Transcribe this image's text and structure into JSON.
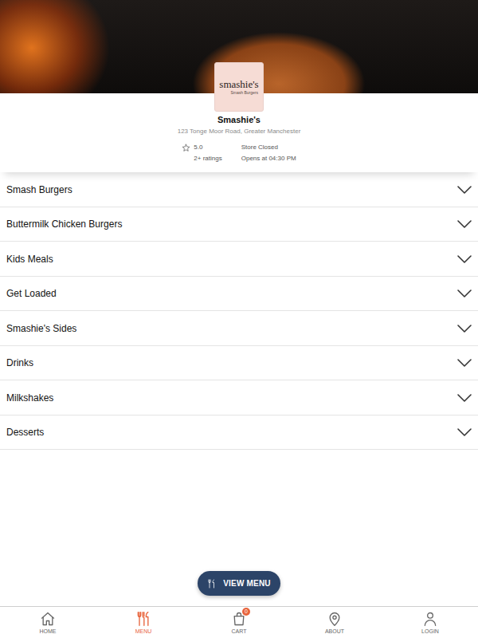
{
  "store": {
    "logo": {
      "title": "smashie's",
      "subtitle": "Smash Burgers"
    },
    "name": "Smashie's",
    "address": "123 Tonge Moor Road, Greater Manchester",
    "rating": "5.0",
    "ratings_count": "2+ ratings",
    "status": "Store Closed",
    "opens": "Opens at 04:30 PM"
  },
  "categories": [
    {
      "label": "Smash Burgers",
      "expanded": false
    },
    {
      "label": "Buttermilk Chicken Burgers",
      "expanded": false
    },
    {
      "label": "Kids Meals",
      "expanded": false
    },
    {
      "label": "Get Loaded",
      "expanded": false
    },
    {
      "label": "Smashie's Sides",
      "expanded": false
    },
    {
      "label": "Drinks",
      "expanded": false
    },
    {
      "label": "Milkshakes",
      "expanded": false
    },
    {
      "label": "Desserts",
      "expanded": false
    }
  ],
  "view_menu_button": {
    "label": "VIEW MENU"
  },
  "bottom_nav": [
    {
      "label": "HOME",
      "selected": false
    },
    {
      "label": "MENU",
      "selected": true
    },
    {
      "label": "CART",
      "selected": false,
      "badge": "0"
    },
    {
      "label": "ABOUT",
      "selected": false
    },
    {
      "label": "LOGIN",
      "selected": false
    }
  ]
}
